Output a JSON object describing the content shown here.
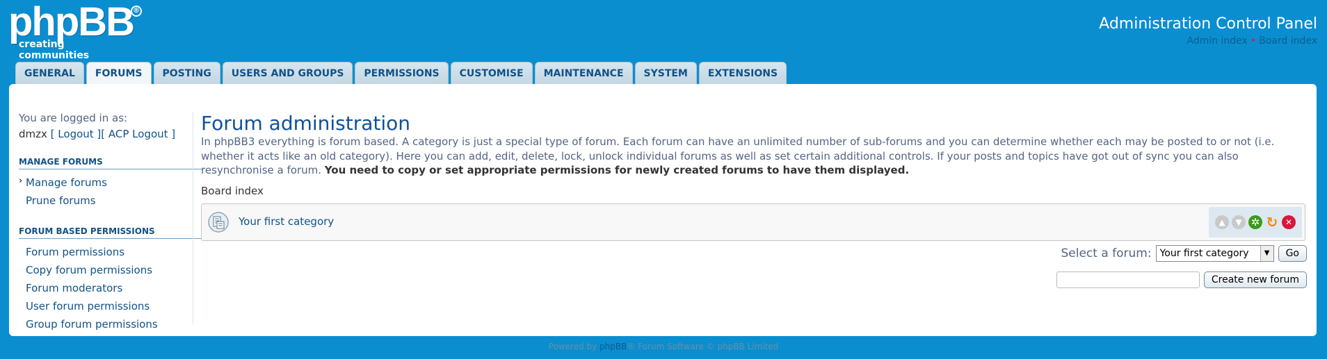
{
  "header": {
    "logo_text": "phpBB",
    "logo_reg": "®",
    "logo_tagline": "creating communities",
    "title": "Administration Control Panel",
    "links": [
      {
        "label": "Admin index"
      },
      {
        "label": "Board index"
      }
    ],
    "link_separator": "•"
  },
  "tabs": [
    {
      "label": "GENERAL",
      "active": false
    },
    {
      "label": "FORUMS",
      "active": true
    },
    {
      "label": "POSTING",
      "active": false
    },
    {
      "label": "USERS AND GROUPS",
      "active": false
    },
    {
      "label": "PERMISSIONS",
      "active": false
    },
    {
      "label": "CUSTOMISE",
      "active": false
    },
    {
      "label": "MAINTENANCE",
      "active": false
    },
    {
      "label": "SYSTEM",
      "active": false
    },
    {
      "label": "EXTENSIONS",
      "active": false
    }
  ],
  "sidebar": {
    "logged_in_label": "You are logged in as:",
    "username": "dmzx",
    "logout": "[ Logout ]",
    "acp_logout": "[ ACP Logout ]",
    "sections": [
      {
        "heading": "MANAGE FORUMS",
        "items": [
          {
            "label": "Manage forums",
            "active": true
          },
          {
            "label": "Prune forums",
            "active": false
          }
        ]
      },
      {
        "heading": "FORUM BASED PERMISSIONS",
        "items": [
          {
            "label": "Forum permissions",
            "active": false
          },
          {
            "label": "Copy forum permissions",
            "active": false
          },
          {
            "label": "Forum moderators",
            "active": false
          },
          {
            "label": "User forum permissions",
            "active": false
          },
          {
            "label": "Group forum permissions",
            "active": false
          }
        ]
      }
    ]
  },
  "main": {
    "title": "Forum administration",
    "description": "In phpBB3 everything is forum based. A category is just a special type of forum. Each forum can have an unlimited number of sub-forums and you can determine whether each may be posted to or not (i.e. whether it acts like an old category). Here you can add, edit, delete, lock, unlock individual forums as well as set certain additional controls. If your posts and topics have got out of sync you can also resynchronise a forum.",
    "description_bold": "You need to copy or set appropriate permissions for newly created forums to have them displayed.",
    "breadcrumb": "Board index",
    "forum_rows": [
      {
        "name": "Your first category"
      }
    ],
    "select_label": "Select a forum:",
    "select_value": "Your first category",
    "go_button": "Go",
    "create_input_value": "",
    "create_button": "Create new forum"
  },
  "colors": {
    "background": "#0a8ed0",
    "link": "#105289",
    "move_disabled": "#c9c9c9",
    "edit_green": "#3a9a1a",
    "sync_orange": "#f08a18",
    "delete_red": "#d6183a"
  },
  "footer": {
    "prefix": "Powered by ",
    "brand": "phpBB",
    "suffix": "® Forum Software © phpBB Limited"
  }
}
